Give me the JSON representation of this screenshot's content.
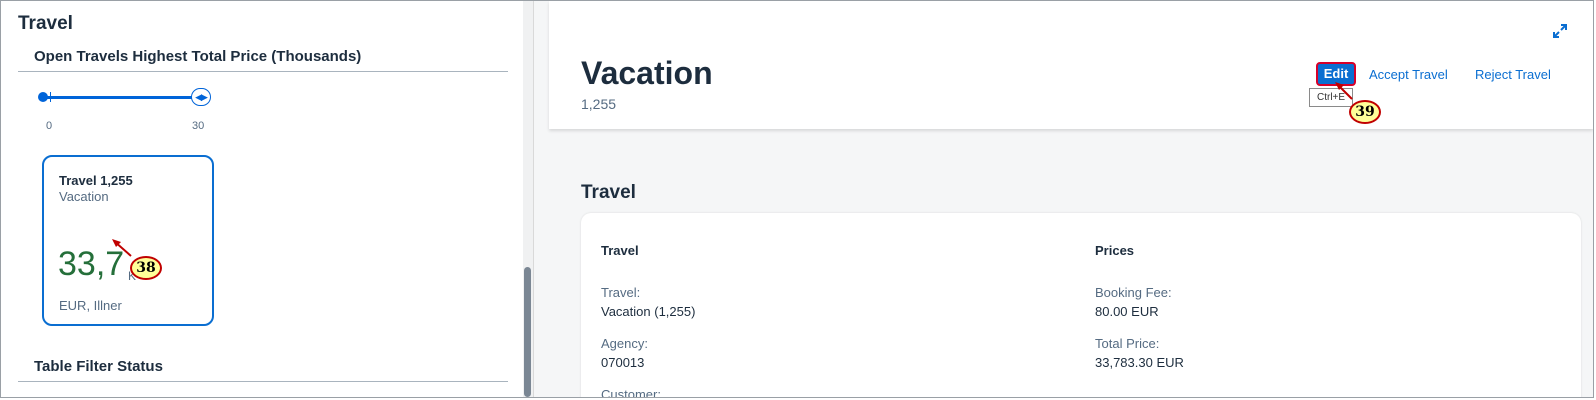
{
  "left_panel": {
    "title": "Travel",
    "chart_section": {
      "title": "Open Travels Highest Total Price (Thousands)",
      "slider": {
        "min_label": "0",
        "max_label": "30"
      }
    },
    "card": {
      "title": "Travel 1,255",
      "subtitle": "Vacation",
      "value": "33,7",
      "value_unit": "K",
      "footer": "EUR, Illner"
    },
    "filter_section": {
      "title": "Table Filter Status"
    }
  },
  "object_page": {
    "title": "Vacation",
    "subtitle": "1,255",
    "actions": {
      "edit": "Edit",
      "accept": "Accept Travel",
      "reject": "Reject Travel"
    },
    "edit_tooltip": "Ctrl+E",
    "section_title": "Travel",
    "groups": [
      {
        "title": "Travel",
        "fields": [
          {
            "label": "Travel:",
            "value": "Vacation (1,255)"
          },
          {
            "label": "Agency:",
            "value": "070013"
          },
          {
            "label": "Customer:",
            "value": ""
          }
        ]
      },
      {
        "title": "Prices",
        "fields": [
          {
            "label": "Booking Fee:",
            "value": "80.00 EUR"
          },
          {
            "label": "Total Price:",
            "value": "33,783.30 EUR"
          }
        ]
      }
    ]
  },
  "annotations": {
    "step_38": "38",
    "step_39": "39"
  },
  "colors": {
    "accent": "#0a6ed1",
    "kpi_positive": "#256f3a",
    "callout_fill": "#ffff99",
    "callout_border": "#c00000"
  }
}
